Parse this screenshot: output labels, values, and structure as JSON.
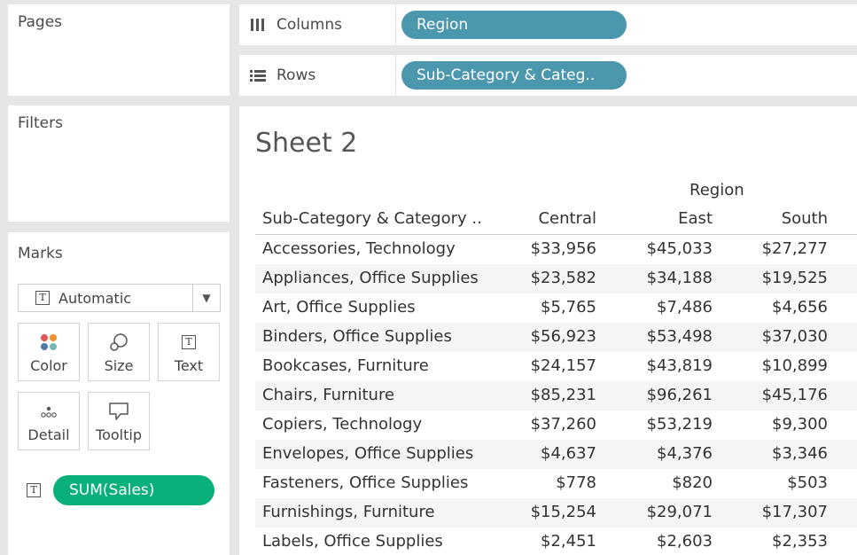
{
  "pages": {
    "title": "Pages"
  },
  "filters": {
    "title": "Filters"
  },
  "marks": {
    "title": "Marks",
    "type_label": "Automatic",
    "buttons": {
      "color": "Color",
      "size": "Size",
      "text": "Text",
      "detail": "Detail",
      "tooltip": "Tooltip"
    },
    "text_field": "SUM(Sales)"
  },
  "shelves": {
    "columns": {
      "label": "Columns",
      "pill": "Region"
    },
    "rows": {
      "label": "Rows",
      "pill": "Sub-Category & Categ.."
    }
  },
  "sheet": {
    "title": "Sheet 2",
    "region_header": "Region",
    "row_header": "Sub-Category & Category ..",
    "columns": [
      "Central",
      "East",
      "South"
    ],
    "rows": [
      {
        "name": "Accessories, Technology",
        "values": [
          "$33,956",
          "$45,033",
          "$27,277"
        ]
      },
      {
        "name": "Appliances, Office Supplies",
        "values": [
          "$23,582",
          "$34,188",
          "$19,525"
        ]
      },
      {
        "name": "Art, Office Supplies",
        "values": [
          "$5,765",
          "$7,486",
          "$4,656"
        ]
      },
      {
        "name": "Binders, Office Supplies",
        "values": [
          "$56,923",
          "$53,498",
          "$37,030"
        ]
      },
      {
        "name": "Bookcases, Furniture",
        "values": [
          "$24,157",
          "$43,819",
          "$10,899"
        ]
      },
      {
        "name": "Chairs, Furniture",
        "values": [
          "$85,231",
          "$96,261",
          "$45,176"
        ]
      },
      {
        "name": "Copiers, Technology",
        "values": [
          "$37,260",
          "$53,219",
          "$9,300"
        ]
      },
      {
        "name": "Envelopes, Office Supplies",
        "values": [
          "$4,637",
          "$4,376",
          "$3,346"
        ]
      },
      {
        "name": "Fasteners, Office Supplies",
        "values": [
          "$778",
          "$820",
          "$503"
        ]
      },
      {
        "name": "Furnishings, Furniture",
        "values": [
          "$15,254",
          "$29,071",
          "$17,307"
        ]
      },
      {
        "name": "Labels, Office Supplies",
        "values": [
          "$2,451",
          "$2,603",
          "$2,353"
        ]
      }
    ]
  },
  "colors": {
    "shelf_pill": "#4b97ad",
    "measure_pill": "#09b07b",
    "background": "#e6e6e6"
  }
}
